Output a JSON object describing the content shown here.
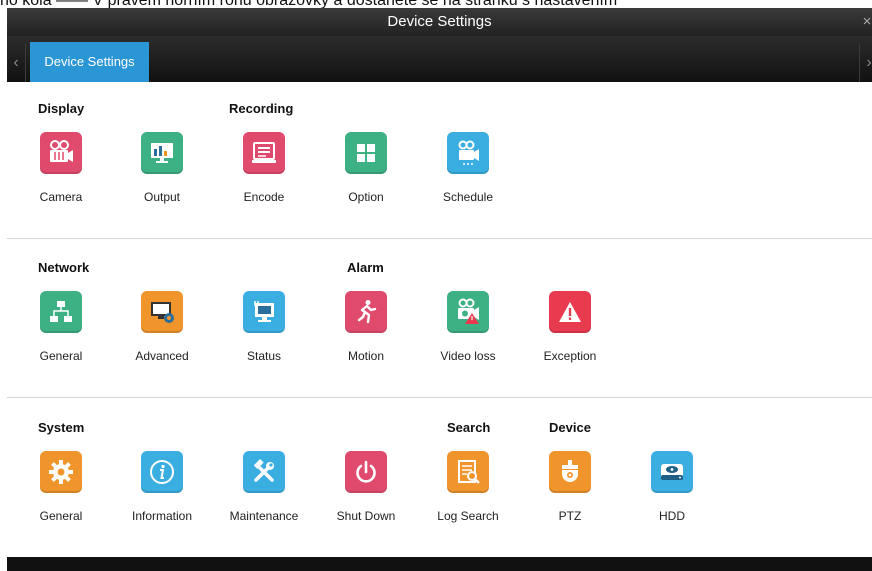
{
  "caption": "ho kola ——  V pravém horním rohu obrazovky a dostanete se na stránku s nastavením",
  "window": {
    "title": "Device Settings",
    "close_glyph": "×"
  },
  "tabs": {
    "left_arrow": "‹",
    "right_arrow": "›",
    "active_label": "Device Settings"
  },
  "colors": {
    "pink": "#e04a6d",
    "green": "#3db084",
    "orange": "#f0942c",
    "blue": "#3aaee0",
    "red": "#e83b4f",
    "tab": "#2b96d6"
  },
  "sections": {
    "s1": {
      "headings": {
        "display": "Display",
        "recording": "Recording"
      },
      "items": [
        {
          "label": "Camera",
          "icon": "camera-settings-icon",
          "color": "pink"
        },
        {
          "label": "Output",
          "icon": "monitor-output-icon",
          "color": "green"
        },
        {
          "label": "Encode",
          "icon": "encode-icon",
          "color": "pink"
        },
        {
          "label": "Option",
          "icon": "grid-option-icon",
          "color": "green"
        },
        {
          "label": "Schedule",
          "icon": "schedule-camera-icon",
          "color": "blue"
        }
      ]
    },
    "s2": {
      "headings": {
        "network": "Network",
        "alarm": "Alarm"
      },
      "items": [
        {
          "label": "General",
          "icon": "network-general-icon",
          "color": "green"
        },
        {
          "label": "Advanced",
          "icon": "network-advanced-icon",
          "color": "orange"
        },
        {
          "label": "Status",
          "icon": "network-status-icon",
          "color": "blue"
        },
        {
          "label": "Motion",
          "icon": "motion-runner-icon",
          "color": "pink"
        },
        {
          "label": "Video loss",
          "icon": "video-loss-icon",
          "color": "green"
        },
        {
          "label": "Exception",
          "icon": "exception-warning-icon",
          "color": "red"
        }
      ]
    },
    "s3": {
      "headings": {
        "system": "System",
        "search": "Search",
        "device": "Device"
      },
      "items": [
        {
          "label": "General",
          "icon": "gear-icon",
          "color": "orange"
        },
        {
          "label": "Information",
          "icon": "info-icon",
          "color": "blue"
        },
        {
          "label": "Maintenance",
          "icon": "tools-icon",
          "color": "blue"
        },
        {
          "label": "Shut Down",
          "icon": "power-icon",
          "color": "pink"
        },
        {
          "label": "Log Search",
          "icon": "log-search-icon",
          "color": "orange"
        },
        {
          "label": "PTZ",
          "icon": "ptz-camera-icon",
          "color": "orange"
        },
        {
          "label": "HDD",
          "icon": "hdd-icon",
          "color": "blue"
        }
      ]
    }
  }
}
